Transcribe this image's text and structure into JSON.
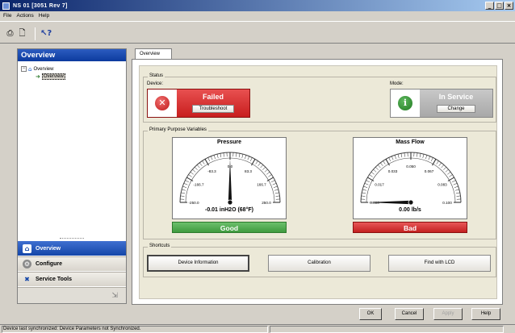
{
  "window": {
    "title": "NS 01 [3051 Rev 7]",
    "minimize": "_",
    "maximize": "□",
    "close": "×"
  },
  "menu": [
    "File",
    "Actions",
    "Help"
  ],
  "toolbar": {
    "icons": [
      "print-icon",
      "print-preview-icon",
      "help-pointer-icon"
    ]
  },
  "sidebar": {
    "header": "Overview",
    "tree": {
      "root": "Overview",
      "child": "Overview"
    },
    "nav": [
      {
        "label": "Overview",
        "icon": "home-icon"
      },
      {
        "label": "Configure",
        "icon": "configure-icon"
      },
      {
        "label": "Service Tools",
        "icon": "service-tools-icon"
      }
    ]
  },
  "tabs": [
    "Overview"
  ],
  "status": {
    "group_label": "Status",
    "device_label": "Device:",
    "device_state": "Failed",
    "troubleshoot": "Troubleshoot",
    "mode_label": "Mode:",
    "mode_state": "In Service",
    "change": "Change"
  },
  "ppv": {
    "group_label": "Primary Purpose Variables",
    "gauges": [
      {
        "title": "Pressure",
        "ticks": [
          "-250.0",
          "-166.7",
          "-83.3",
          "0.0",
          "83.3",
          "166.7",
          "250.0"
        ],
        "min": -250,
        "max": 250,
        "value": -0.01,
        "reading": "-0.01 inH2O (68°F)",
        "quality": "Good"
      },
      {
        "title": "Mass Flow",
        "ticks": [
          "0.000",
          "0.017",
          "0.033",
          "0.050",
          "0.067",
          "0.083",
          "0.100"
        ],
        "min": 0,
        "max": 0.1,
        "value": 0.0,
        "reading": "0.00 lb/s",
        "quality": "Bad"
      }
    ]
  },
  "shortcuts": {
    "group_label": "Shortcuts",
    "buttons": [
      "Device Information",
      "Calibration",
      "Find with LCD"
    ]
  },
  "footer": {
    "ok": "OK",
    "cancel": "Cancel",
    "apply": "Apply",
    "help": "Help"
  },
  "statusbar": {
    "text": "Device last synchronized: Device Parameters not Synchronized."
  },
  "colors": {
    "good": "#4caf50",
    "bad": "#d32f2f",
    "header": "#1446a8"
  }
}
